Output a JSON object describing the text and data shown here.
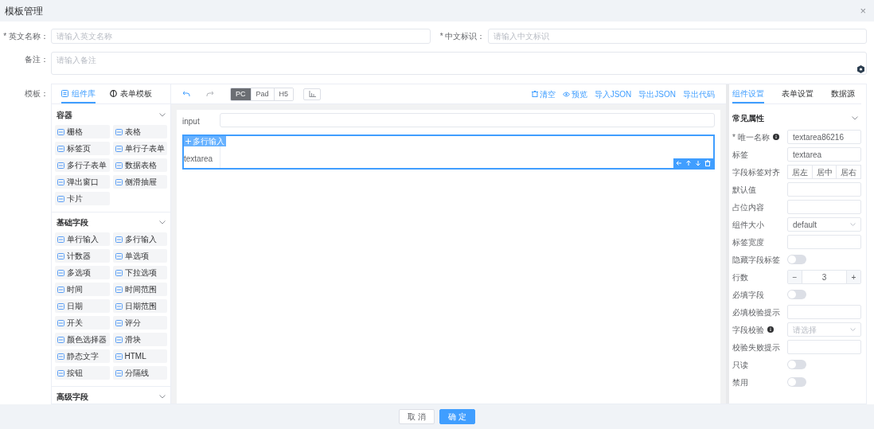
{
  "dialog": {
    "title": "模板管理",
    "close": "×"
  },
  "form": {
    "fields": [
      {
        "label": "* 英文名称：",
        "placeholder": "请输入英文名称"
      },
      {
        "label": "* 中文标识：",
        "placeholder": "请输入中文标识"
      }
    ],
    "remark": {
      "label": "备注：",
      "placeholder": "请输入备注"
    },
    "template_label": "模板："
  },
  "designer": {
    "left_tabs": [
      {
        "label": "组件库",
        "selected": true
      },
      {
        "label": "表单模板",
        "selected": false
      }
    ],
    "groups": [
      {
        "title": "容器",
        "expanded": true,
        "items": [
          "栅格",
          "表格",
          "标签页",
          "单行子表单",
          "多行子表单",
          "数据表格",
          "弹出窗口",
          "侧滑抽屉",
          "卡片"
        ]
      },
      {
        "title": "基础字段",
        "expanded": true,
        "items": [
          "单行输入",
          "多行输入",
          "计数器",
          "单选项",
          "多选项",
          "下拉选项",
          "时间",
          "时间范围",
          "日期",
          "日期范围",
          "开关",
          "评分",
          "颜色选择器",
          "滑块",
          "静态文字",
          "HTML",
          "按钮",
          "分隔线"
        ]
      },
      {
        "title": "高级字段",
        "expanded": true
      }
    ],
    "devices": [
      {
        "label": "PC",
        "selected": true
      },
      {
        "label": "Pad",
        "selected": false
      },
      {
        "label": "H5",
        "selected": false
      }
    ],
    "actions": [
      {
        "label": "清空",
        "kind": "clear"
      },
      {
        "label": "预览",
        "kind": "preview"
      },
      {
        "label": "导入JSON",
        "kind": "plain"
      },
      {
        "label": "导出JSON",
        "kind": "plain"
      },
      {
        "label": "导出代码",
        "kind": "plain"
      }
    ],
    "canvas": {
      "input_label": "input",
      "selected_widget": {
        "badge": "多行输入",
        "label": "textarea"
      }
    },
    "right_tabs": [
      {
        "label": "组件设置",
        "selected": true
      },
      {
        "label": "表单设置",
        "selected": false
      },
      {
        "label": "数据源",
        "selected": false
      }
    ],
    "section": {
      "title": "常见属性",
      "expanded": true
    },
    "props": [
      {
        "label": "* 唯一名称",
        "kind": "input",
        "info": true,
        "value": "textarea86216"
      },
      {
        "label": "标签",
        "kind": "input",
        "value": "textarea"
      },
      {
        "label": "字段标签对齐",
        "kind": "buttons",
        "options": [
          "居左",
          "居中",
          "居右"
        ]
      },
      {
        "label": "默认值",
        "kind": "input"
      },
      {
        "label": "占位内容",
        "kind": "input"
      },
      {
        "label": "组件大小",
        "kind": "select",
        "value": "default"
      },
      {
        "label": "标签宽度",
        "kind": "input"
      },
      {
        "label": "隐藏字段标签",
        "kind": "switch",
        "on": false
      },
      {
        "label": "行数",
        "kind": "number",
        "minus": "−",
        "value": "3",
        "plus": "+"
      },
      {
        "label": "必填字段",
        "kind": "switch",
        "on": false
      },
      {
        "label": "必填校验提示",
        "kind": "input"
      },
      {
        "label": "字段校验",
        "kind": "select",
        "info": true,
        "placeholder": "请选择"
      },
      {
        "label": "校验失败提示",
        "kind": "input"
      },
      {
        "label": "只读",
        "kind": "switch",
        "on": false
      },
      {
        "label": "禁用",
        "kind": "switch",
        "on": false
      }
    ]
  },
  "footer": {
    "buttons": [
      {
        "label": "取 消",
        "kind": "default"
      },
      {
        "label": "确 定",
        "kind": "primary"
      }
    ]
  }
}
